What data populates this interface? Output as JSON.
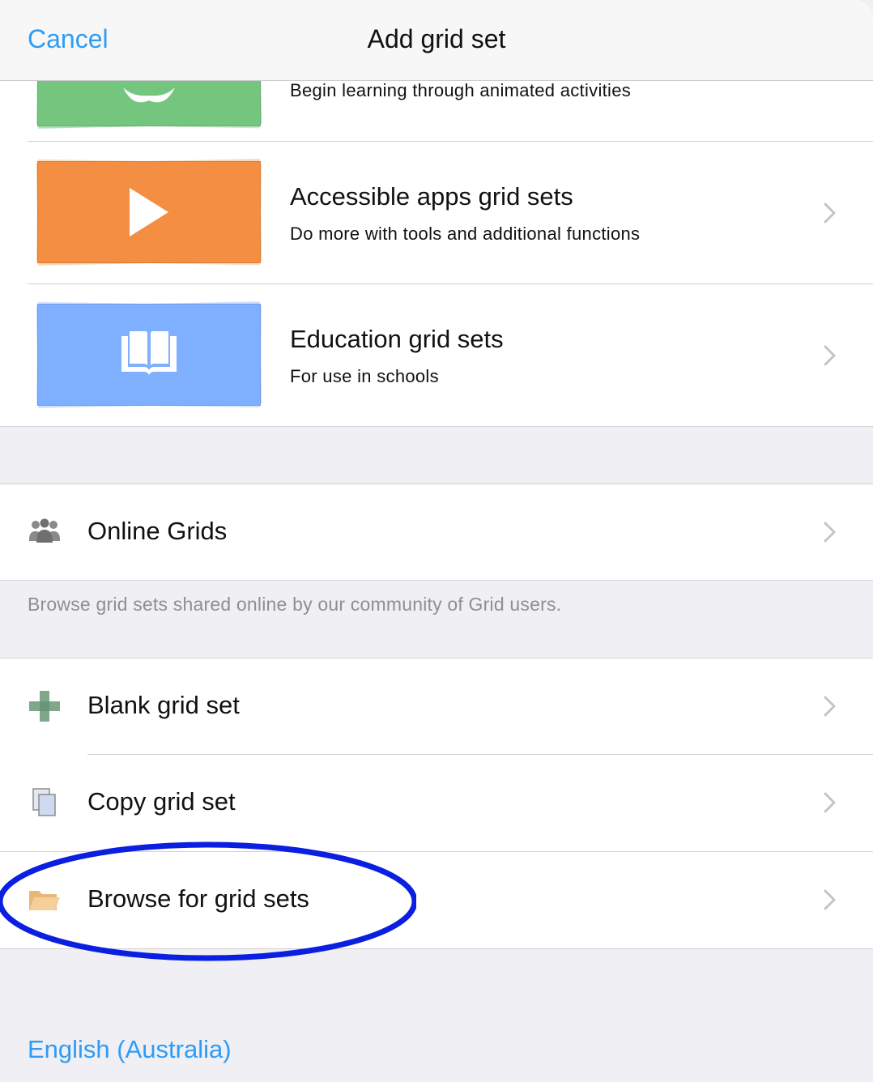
{
  "header": {
    "cancel_label": "Cancel",
    "title": "Add grid set"
  },
  "categories": [
    {
      "subtitle": "Begin learning through animated activities",
      "icon": "apple-icon",
      "color": "#74c67f"
    },
    {
      "title": "Accessible apps grid sets",
      "subtitle": "Do more with tools and additional functions",
      "icon": "play-icon",
      "color": "#f48e42"
    },
    {
      "title": "Education grid sets",
      "subtitle": "For use in schools",
      "icon": "book-icon",
      "color": "#7fafff"
    }
  ],
  "online": {
    "label": "Online Grids",
    "icon": "people-icon",
    "note": "Browse grid sets shared online by our community of Grid users."
  },
  "actions": [
    {
      "label": "Blank grid set",
      "icon": "plus-icon"
    },
    {
      "label": "Copy grid set",
      "icon": "copy-icon"
    },
    {
      "label": "Browse for grid sets",
      "icon": "folder-icon"
    }
  ],
  "language": "English (Australia)",
  "colors": {
    "accent": "#2e9cf5",
    "highlight_ring": "#0a1fe0"
  }
}
